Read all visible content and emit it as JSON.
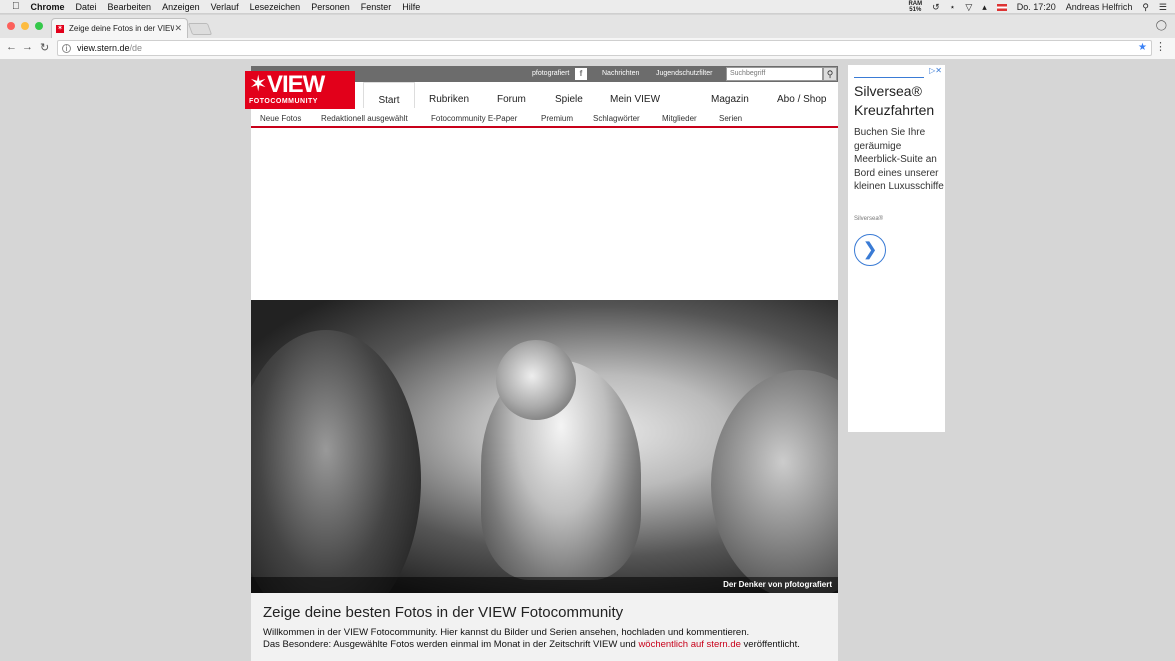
{
  "macos": {
    "app": "Chrome",
    "menu": [
      "Datei",
      "Bearbeiten",
      "Anzeigen",
      "Verlauf",
      "Lesezeichen",
      "Personen",
      "Fenster",
      "Hilfe"
    ],
    "ram_label": "RAM",
    "ram_value": "51%",
    "clock": "Do. 17:20",
    "user": "Andreas Helfrich"
  },
  "browser": {
    "tab_title": "Zeige deine Fotos in der VIEW",
    "url_domain": "view.stern.de",
    "url_path": "/de"
  },
  "site": {
    "logo_text": "VIEW",
    "logo_sub": "FOTOCOMMUNITY",
    "top_links": [
      "pfotografiert",
      "Nachrichten",
      "Jugendschutzfilter"
    ],
    "search_placeholder": "Suchbegriff",
    "main_nav": [
      "Start",
      "Rubriken",
      "Forum",
      "Spiele",
      "Mein VIEW",
      "Magazin",
      "Abo / Shop"
    ],
    "sub_nav": [
      "Neue Fotos",
      "Redaktionell ausgewählt",
      "Fotocommunity E-Paper",
      "Premium",
      "Schlagwörter",
      "Mitglieder",
      "Serien"
    ],
    "hero_caption": "Der Denker von pfotografiert",
    "intro_title": "Zeige deine besten Fotos in der VIEW Fotocommunity",
    "intro_line1": "Willkommen in der VIEW Fotocommunity. Hier kannst du Bilder und Serien ansehen, hochladen und kommentieren.",
    "intro_line2_pre": "Das Besondere: Ausgewählte Fotos werden einmal im Monat in der Zeitschrift VIEW und ",
    "intro_link": "wöchentlich auf stern.de",
    "intro_line2_post": " veröffentlicht.",
    "accent_color": "#e2001a"
  },
  "ad": {
    "title": "Silversea® Kreuzfahrten",
    "body": "Buchen Sie Ihre geräumige Meerblick-Suite an Bord eines unserer kleinen Luxusschiffe",
    "brand": "Silversea®"
  }
}
